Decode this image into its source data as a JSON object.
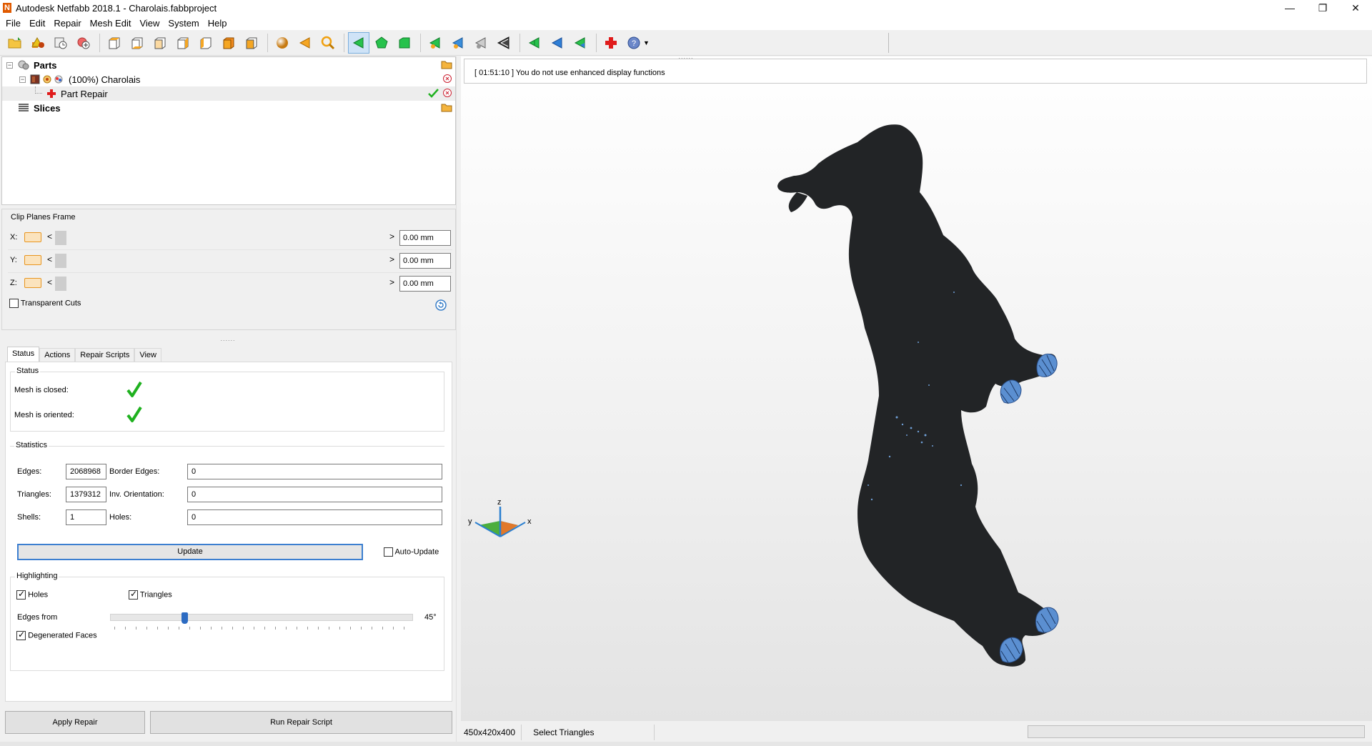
{
  "window": {
    "title": "Autodesk Netfabb 2018.1 - Charolais.fabbproject",
    "app_icon_letter": "N",
    "minimize": "—",
    "restore": "❐",
    "close": "✕"
  },
  "menu": [
    "File",
    "Edit",
    "Repair",
    "Mesh Edit",
    "View",
    "System",
    "Help"
  ],
  "tree": {
    "parts_label": "Parts",
    "part_label": "(100%) Charolais",
    "repair_label": "Part Repair",
    "slices_label": "Slices"
  },
  "clip": {
    "title": "Clip Planes Frame",
    "rows": [
      {
        "axis": "X:",
        "value": "0.00 mm"
      },
      {
        "axis": "Y:",
        "value": "0.00 mm"
      },
      {
        "axis": "Z:",
        "value": "0.00 mm"
      }
    ],
    "transparent_cuts": "Transparent Cuts",
    "arrow_left": "<",
    "arrow_right": ">"
  },
  "tabs": [
    "Status",
    "Actions",
    "Repair Scripts",
    "View"
  ],
  "status_group": {
    "title": "Status",
    "mesh_closed": "Mesh is closed:",
    "mesh_oriented": "Mesh is oriented:"
  },
  "statistics": {
    "title": "Statistics",
    "edges_label": "Edges:",
    "edges_value": "2068968",
    "border_edges_label": "Border Edges:",
    "border_edges_value": "0",
    "triangles_label": "Triangles:",
    "triangles_value": "1379312",
    "inv_orientation_label": "Inv. Orientation:",
    "inv_orientation_value": "0",
    "shells_label": "Shells:",
    "shells_value": "1",
    "holes_label": "Holes:",
    "holes_value": "0",
    "update_button": "Update",
    "auto_update": "Auto-Update"
  },
  "highlighting": {
    "title": "Highlighting",
    "holes": "Holes",
    "triangles": "Triangles",
    "edges_from": "Edges from",
    "angle_value": "45°",
    "angle_fraction": 0.24,
    "degenerated_faces": "Degenerated Faces"
  },
  "buttons": {
    "apply_repair": "Apply Repair",
    "run_repair_script": "Run Repair Script"
  },
  "viewport": {
    "log_message": "[ 01:51:10 ] You do not use enhanced display functions",
    "axis_x": "x",
    "axis_y": "y",
    "axis_z": "z"
  },
  "statusbar": {
    "dimensions": "450x420x400",
    "mode": "Select Triangles"
  },
  "colors": {
    "accent_blue": "#3c7fd0",
    "check_green": "#1fb11f",
    "model_dark": "#222426"
  }
}
